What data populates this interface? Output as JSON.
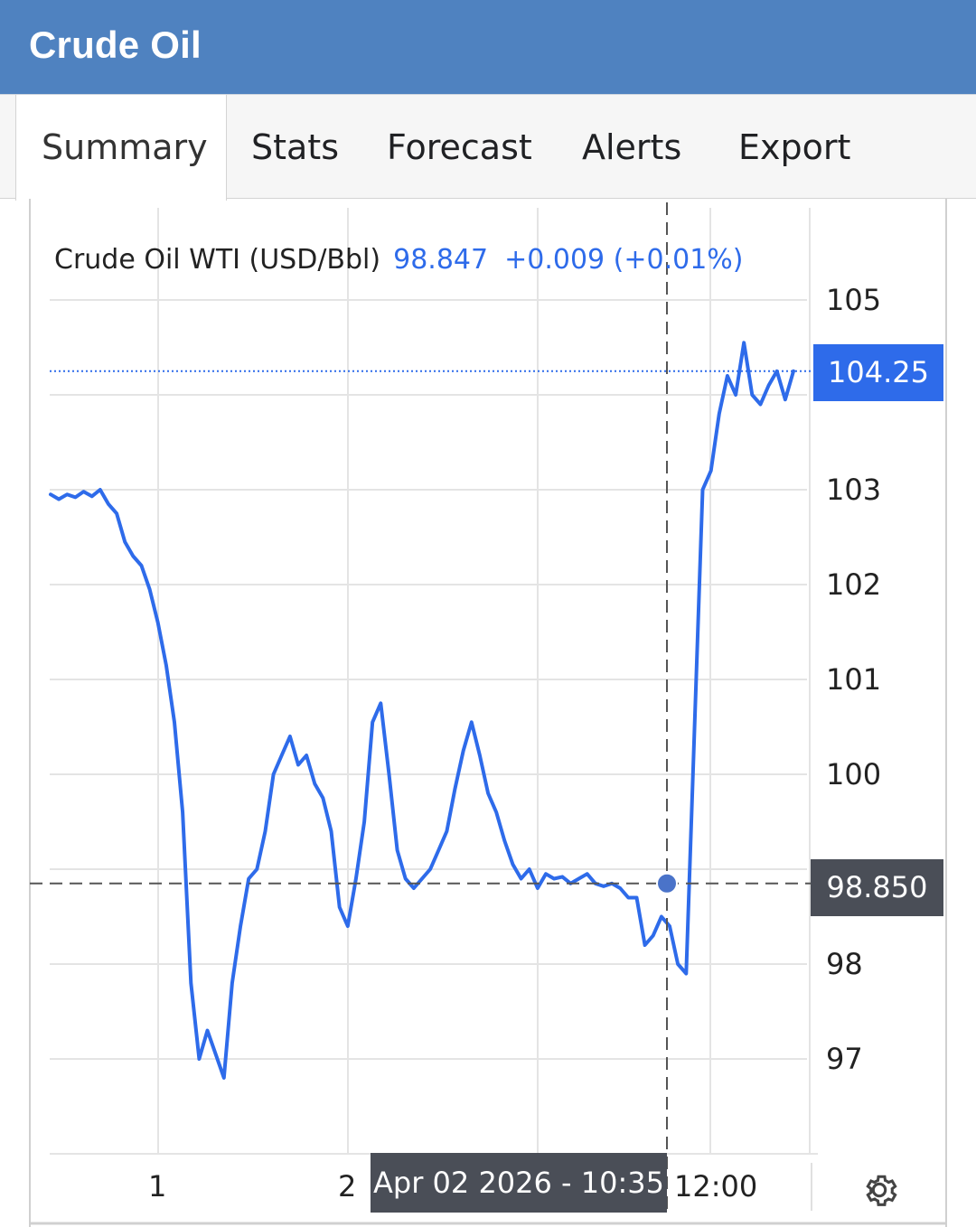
{
  "header": {
    "title": "Crude Oil"
  },
  "tabs": [
    {
      "label": "Summary",
      "active": true
    },
    {
      "label": "Stats",
      "active": false
    },
    {
      "label": "Forecast",
      "active": false
    },
    {
      "label": "Alerts",
      "active": false
    },
    {
      "label": "Export",
      "active": false
    }
  ],
  "legend": {
    "name": "Crude Oil WTI (USD/Bbl)",
    "value": "98.847",
    "change": "+0.009 (+0.01%)"
  },
  "badges": {
    "last_price": "104.25",
    "crosshair_price": "98.850",
    "crosshair_time": "Apr 02 2026 - 10:35"
  },
  "colors": {
    "header": "#4f82c0",
    "line": "#2e6bea",
    "badge_dark": "#4a4e57"
  },
  "icons": {
    "settings": "gear-icon"
  },
  "chart_data": {
    "type": "line",
    "series": [
      {
        "name": "Crude Oil WTI (USD/Bbl)",
        "values": [
          102.95,
          102.9,
          102.95,
          102.92,
          102.98,
          102.93,
          103.0,
          102.85,
          102.75,
          102.45,
          102.3,
          102.2,
          101.95,
          101.6,
          101.15,
          100.55,
          99.6,
          97.8,
          97.0,
          97.3,
          97.05,
          96.8,
          97.8,
          98.4,
          98.9,
          99.0,
          99.4,
          100.0,
          100.2,
          100.4,
          100.1,
          100.2,
          99.9,
          99.75,
          99.4,
          98.6,
          98.4,
          98.9,
          99.5,
          100.55,
          100.75,
          100.0,
          99.2,
          98.9,
          98.8,
          98.9,
          99.0,
          99.2,
          99.4,
          99.85,
          100.25,
          100.55,
          100.2,
          99.8,
          99.6,
          99.3,
          99.05,
          98.9,
          99.0,
          98.8,
          98.95,
          98.9,
          98.92,
          98.85,
          98.9,
          98.95,
          98.85,
          98.82,
          98.85,
          98.8,
          98.7,
          98.7,
          98.2,
          98.3,
          98.5,
          98.4,
          98.0,
          97.9,
          100.45,
          103.0,
          103.2,
          103.8,
          104.2,
          104.0,
          104.55,
          104.0,
          103.9,
          104.1,
          104.25,
          103.95,
          104.25
        ],
        "last": 104.25
      }
    ],
    "x_ticks": [
      "1",
      "2",
      "12:00"
    ],
    "y_ticks": [
      105,
      103,
      102,
      101,
      100,
      98,
      97
    ],
    "ylim": [
      96.0,
      105.5
    ],
    "crosshair": {
      "price": 98.85,
      "time": "Apr 02 2026 - 10:35"
    },
    "grid": true
  }
}
